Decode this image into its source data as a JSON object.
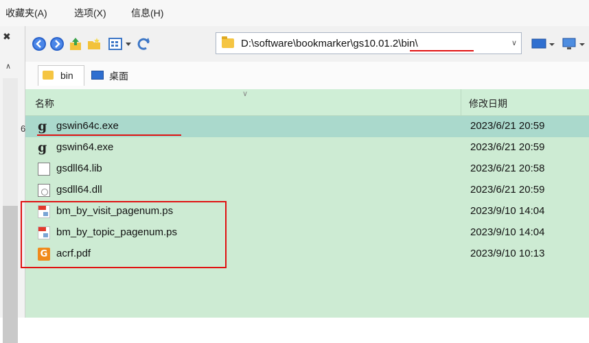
{
  "menubar": {
    "items": [
      "收藏夹(A)",
      "选项(X)",
      "信息(H)"
    ]
  },
  "left_pane": {
    "close_glyph": "✖",
    "up_glyph": "∧",
    "clipped_text": "6"
  },
  "toolbar": {
    "address": "D:\\software\\bookmarker\\gs10.01.2\\bin\\",
    "address_dropdown_glyph": "∨"
  },
  "tabs": [
    {
      "label": "bin",
      "icon": "folder-icon"
    },
    {
      "label": "桌面",
      "icon": "desktop-icon"
    }
  ],
  "list": {
    "columns": {
      "name": "名称",
      "date": "修改日期"
    },
    "sort_glyph": "∨",
    "rows": [
      {
        "name": "gswin64c.exe",
        "date": "2023/6/21 20:59",
        "icon": "ghostscript-icon",
        "selected": true
      },
      {
        "name": "gswin64.exe",
        "date": "2023/6/21 20:59",
        "icon": "ghostscript-icon",
        "selected": false
      },
      {
        "name": "gsdll64.lib",
        "date": "2023/6/21 20:58",
        "icon": "document-icon",
        "selected": false
      },
      {
        "name": "gsdll64.dll",
        "date": "2023/6/21 20:59",
        "icon": "dll-icon",
        "selected": false
      },
      {
        "name": "bm_by_visit_pagenum.ps",
        "date": "2023/9/10 14:04",
        "icon": "postscript-icon",
        "selected": false
      },
      {
        "name": "bm_by_topic_pagenum.ps",
        "date": "2023/9/10 14:04",
        "icon": "postscript-icon",
        "selected": false
      },
      {
        "name": "acrf.pdf",
        "date": "2023/9/10 10:13",
        "icon": "pdf-icon",
        "selected": false
      }
    ],
    "pdf_glyph": "G",
    "gs_glyph": "g"
  },
  "colors": {
    "list_bg": "#cdebd3",
    "selected_bg": "#aad9cc",
    "annotation_red": "#e01010"
  }
}
